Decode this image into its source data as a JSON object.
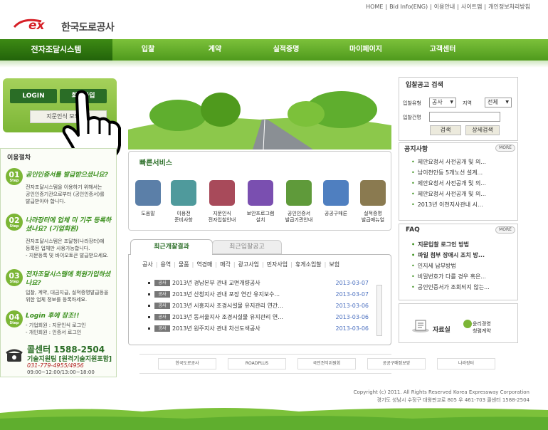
{
  "topnav": [
    "HOME",
    "Bid Info(ENG)",
    "이용안내",
    "사이트맵",
    "개인정보처리방침"
  ],
  "logo": {
    "mark": "ex",
    "name": "한국도로공사"
  },
  "mainnav": {
    "home": "전자조달시스템",
    "items": [
      "입찰",
      "계약",
      "실적증명",
      "마이페이지",
      "고객센터"
    ]
  },
  "login": {
    "login_label": "LOGIN",
    "join_label": "회원가입",
    "finger_label": "지문인식 모의인증"
  },
  "steps": {
    "title": "이용절차",
    "step_word": "Step",
    "items": [
      {
        "num": "01",
        "title": "공인인증서를 발급받으셨나요?",
        "desc": [
          "전자조달시스템을 이용하기 위해서는",
          "공인인증기관으로부터 (공인인증서)를",
          "발급받아야 합니다."
        ]
      },
      {
        "num": "02",
        "title": "나라장터에 업체 미 기주 등록하셨나요? (기업회원)",
        "desc": [
          "전자조달시스템은 조달청(나라장터)에",
          "등록된 업체만 사용가능합니다.",
          "- 지문등록 및 바이오토큰 발급받으세요."
        ]
      },
      {
        "num": "03",
        "title": "전자조달시스템에 회원가입하셨나요?",
        "desc": [
          "입찰, 계약, 대금지급, 실적증명발급등을",
          "위한 업체 정보를 등록하세요."
        ]
      },
      {
        "num": "04",
        "title": "Login 후에 참조!!",
        "desc": [
          "- 기업회원 : 지문인식 로그인",
          "- 개인회원 : 인증서 로그인"
        ]
      }
    ]
  },
  "callcenter": {
    "title": "콜센터 1588-2504",
    "tech": "기술지원팀 [원격기술지원포함]",
    "phone": "031-779-4955/4956",
    "hours": "09:00~12:00/13:00~18:00"
  },
  "quick": {
    "title": "빠른서비스",
    "items": [
      {
        "label": [
          "도움말"
        ],
        "color": "#5b7fa8"
      },
      {
        "label": [
          "이용전",
          "준비사항"
        ],
        "color": "#4f9a9c"
      },
      {
        "label": [
          "지문인식",
          "전자입찰안내"
        ],
        "color": "#a84a5a"
      },
      {
        "label": [
          "보안프로그램",
          "설치"
        ],
        "color": "#7a4fb0"
      },
      {
        "label": [
          "공인인증서",
          "발급기관안내"
        ],
        "color": "#5f9a3a"
      },
      {
        "label": [
          "공공구매론"
        ],
        "color": "#4f7fc0"
      },
      {
        "label": [
          "실적증명",
          "발급매뉴얼"
        ],
        "color": "#8a7a50"
      }
    ]
  },
  "tabs": {
    "active": "최근개찰결과",
    "inactive": "최근입찰공고"
  },
  "categories": [
    "공사",
    "용역",
    "물품",
    "역경매",
    "매각",
    "광고사업",
    "민자사업",
    "휴게소입찰",
    "보험"
  ],
  "bids": [
    {
      "badge": "공사",
      "title": "2013년 경남본부 관내 교면개량공사",
      "date": "2013-03-07"
    },
    {
      "badge": "공사",
      "title": "2013년 산청지사 관내 포장 연간 유지보수...",
      "date": "2013-03-07"
    },
    {
      "badge": "공사",
      "title": "2013년 시흥지사 조경시설물 유지관리 연간...",
      "date": "2013-03-06"
    },
    {
      "badge": "공사",
      "title": "2013년 동서울지사 조경시설물 유지관리 연...",
      "date": "2013-03-06"
    },
    {
      "badge": "공사",
      "title": "2013년 원주지사 관내 차선도색공사",
      "date": "2013-03-06"
    }
  ],
  "partners": [
    "한국도로공사",
    "ROADPLUS",
    "국민권익위원회",
    "공공구매정보망",
    "나라장터"
  ],
  "bidsearch": {
    "title": "입찰공고 검색",
    "type_label": "입찰유형",
    "type_value": "공사",
    "region_label": "지역",
    "region_value": "전체",
    "name_label": "입찰건명",
    "search_label": "검색",
    "detail_label": "상세검색"
  },
  "notice": {
    "title": "공지사항",
    "more": "MORE",
    "items": [
      "제안요청서 사전공개 및 의...",
      "남이천안등 5개노선 설계...",
      "제안요청서 사전공개 및 의...",
      "제안요청서 사전공개 및 의...",
      "2013년 이천지사관내 시..."
    ]
  },
  "faq": {
    "title": "FAQ",
    "more": "MORE",
    "items": [
      "지문입찰 로그인 방법",
      "파일 첨부 장애시 조치 방...",
      "인지세 납부방법",
      "비밀번호가 다를 경우 혹은...",
      "공인인증서가 조회되지 않는..."
    ]
  },
  "datacenter": "자료실",
  "ethics": [
    "윤리경영",
    "청렴계약"
  ],
  "footer": {
    "copyright": "Copyright (c) 2011. All Rights Reserved Korea Expressway Corporation",
    "address": "경기도 성남시 수정구 대왕판교로 805 우 461-703   콜센터 1588-2504"
  }
}
